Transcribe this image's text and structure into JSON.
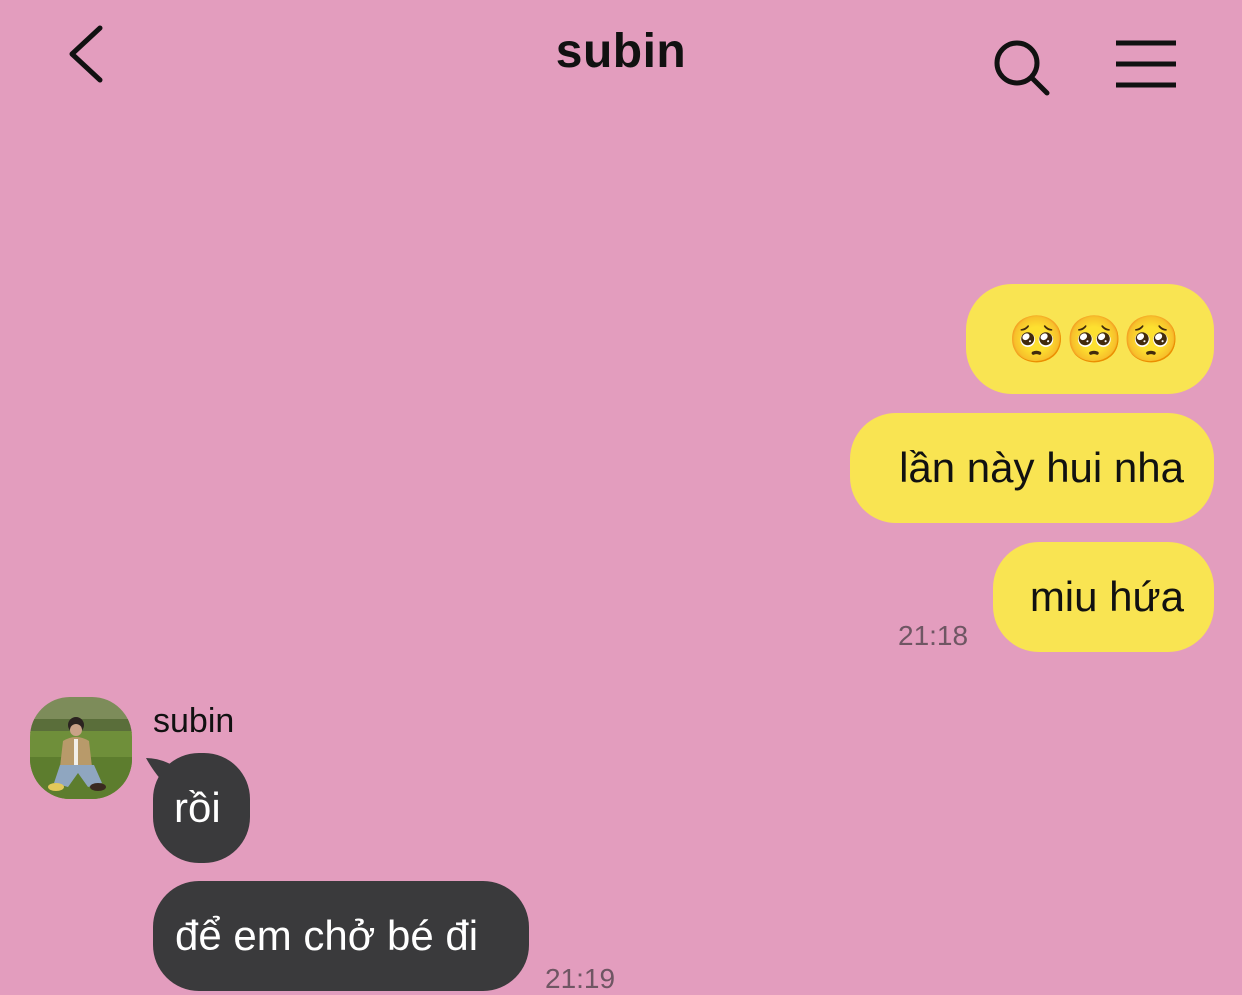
{
  "header": {
    "title": "subin",
    "back_icon": "chevron-left-icon",
    "search_icon": "search-icon",
    "menu_icon": "menu-icon"
  },
  "colors": {
    "background": "#e39dbe",
    "my_bubble": "#f9e452",
    "their_bubble": "#3a3a3c",
    "timestamp": "#6f5663"
  },
  "messages": {
    "sent": [
      {
        "text": "🥺🥺🥺"
      },
      {
        "text": "lần này hui nha"
      },
      {
        "text": "miu hứa"
      }
    ],
    "sent_time": "21:18",
    "sender_name": "subin",
    "avatar_icon": "profile-photo",
    "received": [
      {
        "text": "rồi"
      },
      {
        "text": "để em chở bé đi"
      }
    ],
    "received_time": "21:19"
  }
}
